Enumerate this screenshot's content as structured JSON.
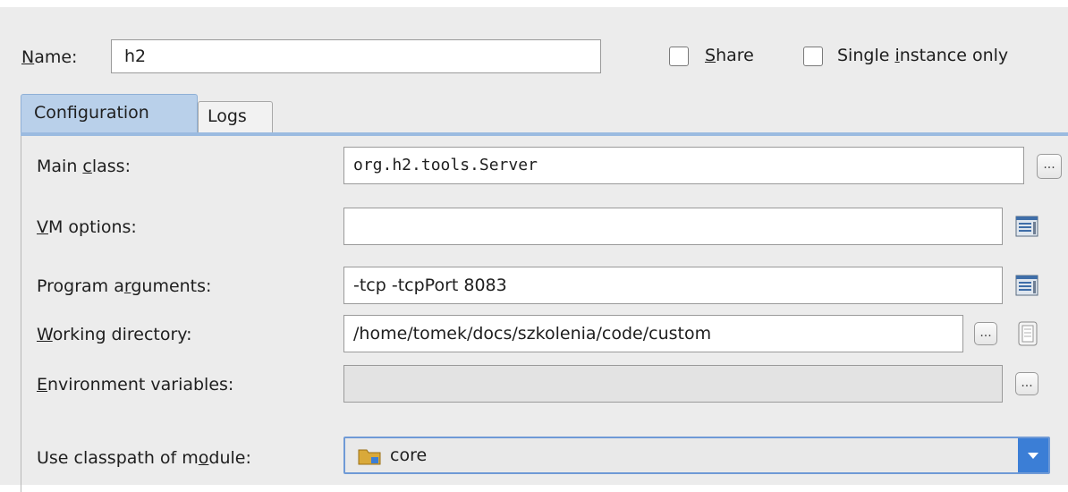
{
  "header": {
    "name_label_u": "N",
    "name_label_rest": "ame:",
    "name_value": "h2",
    "share_label_u": "S",
    "share_label_rest": "hare",
    "single_label_pre": "Single ",
    "single_label_u": "i",
    "single_label_rest": "nstance only",
    "share_checked": false,
    "single_instance_checked": false
  },
  "tabs": [
    {
      "label": "Configuration",
      "active": true
    },
    {
      "label": "Logs",
      "active": false
    }
  ],
  "fields": {
    "main_class": {
      "label_pre": "Main ",
      "label_u": "c",
      "label_rest": "lass:",
      "value": "org.h2.tools.Server"
    },
    "vm_options": {
      "label_pre": "",
      "label_u": "V",
      "label_rest": "M options:",
      "value": ""
    },
    "program_arguments": {
      "label_pre": "Program a",
      "label_u": "r",
      "label_rest": "guments:",
      "value": "-tcp -tcpPort 8083"
    },
    "working_directory": {
      "label_pre": "",
      "label_u": "W",
      "label_rest": "orking directory:",
      "value": "/home/tomek/docs/szkolenia/code/custom"
    },
    "environment_variables": {
      "label_pre": "",
      "label_u": "E",
      "label_rest": "nvironment variables:",
      "value": ""
    },
    "classpath_module": {
      "label_pre": "Use classpath of m",
      "label_u": "o",
      "label_rest": "dule:",
      "value": "core"
    }
  },
  "buttons": {
    "browse": "..."
  },
  "icons": {
    "browse": "ellipsis-icon",
    "expand_editor": "expand-editor-icon",
    "insert_macro": "document-icon",
    "module_folder": "module-folder-icon",
    "dropdown": "chevron-down-icon"
  },
  "colors": {
    "accent": "#3b7ed6",
    "tab_active": "#b9d0ea",
    "panel_bg": "#ececec"
  }
}
